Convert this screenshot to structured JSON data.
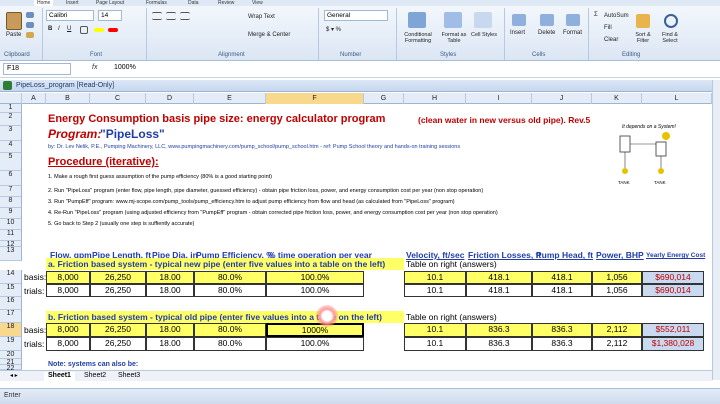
{
  "ribbon": {
    "tabs": [
      "Home",
      "Insert",
      "Page Layout",
      "Formulas",
      "Data",
      "Review",
      "View"
    ],
    "paste_label": "Paste",
    "font_name": "Calibri",
    "font_size": "14",
    "wrap_text": "Wrap Text",
    "merge_center": "Merge & Center",
    "number_format": "General",
    "conditional_formatting": "Conditional Formatting",
    "format_as_table": "Format as Table",
    "cell_styles": "Cell Styles",
    "insert": "Insert",
    "delete": "Delete",
    "format": "Format",
    "autosum": "AutoSum",
    "fill": "Fill",
    "clear": "Clear",
    "sort_filter": "Sort & Filter",
    "find_select": "Find & Select",
    "groups": [
      "Clipboard",
      "Font",
      "Alignment",
      "Number",
      "Styles",
      "Cells",
      "Editing"
    ]
  },
  "formula_bar": {
    "name_box": "F18",
    "fx": "fx",
    "value": "1000%"
  },
  "workbook": {
    "title": "PipeLoss_program  [Read-Only]"
  },
  "columns": [
    "A",
    "B",
    "C",
    "D",
    "E",
    "F",
    "G",
    "H",
    "I",
    "J",
    "K",
    "L"
  ],
  "rows": [
    "1",
    "2",
    "3",
    "4",
    "5",
    "6",
    "7",
    "8",
    "9",
    "10",
    "11",
    "12",
    "13",
    "14",
    "15",
    "16",
    "17",
    "18",
    "19",
    "20",
    "21",
    "22"
  ],
  "sheet": {
    "title_main": "Energy Consumption basis pipe size: energy calculator program",
    "title_sub": "(clean water in new versus old pipe). Rev.5",
    "program_label": "Program:",
    "program_name": "\"PipeLoss\"",
    "byline": "by: Dr. Lev Nelik, P.E., Pumping Machinery, LLC, www.pumpingmachinery.com/pump_school/pump_school.htm - ref: Pump School theory and hands-on training sessions",
    "procedure_heading": "Procedure (iterative):",
    "steps": [
      "1. Make a rough first guess assumption of the pump efficiency (80% is a good starting point)",
      "2. Run \"PipeLoss\" program (enter flow, pipe length, pipe diameter, guessed efficiency) - obtain pipe friction loss, power, and energy consumption cost per year (non stop operation)",
      "3. Run \"PumpEff\" program: www.mj-scope.com/pump_tools/pump_efficiency.htm to adjust pump efficiency from flow and head (as calculated from \"PipeLoss\" program)",
      "4. Re-Run \"PipeLoss\" program (using adjusted efficiency from \"PumpEff\" program - obtain corrected pipe friction loss, power, and energy consumption cost per year (non stop operation)",
      "5. Go back to Step 2 (usually one step is suffiently accurate)"
    ],
    "headers": [
      "Flow, gpm",
      "Pipe Length, ft",
      "Pipe Dia, in",
      "Pump Efficiency, %",
      "% time operation per year",
      "Velocity, ft/sec",
      "Friction Losses, ft",
      "Pump Head, ft",
      "Power, BHP",
      "Yearly Energy Cost"
    ],
    "section_a": "a. Friction based system - typical new pipe (enter five values into a table on the left)",
    "section_b": "b. Friction based system - typical old pipe (enter five values into a table on the left)",
    "table_on_right": "Table on right (answers)",
    "basis_label": "basis:",
    "trials_label": "trials:",
    "new_basis": [
      "8,000",
      "26,250",
      "18.00",
      "80.0%",
      "100.0%",
      "10.1",
      "418.1",
      "418.1",
      "1,056",
      "$690,014"
    ],
    "new_trials": [
      "8,000",
      "26,250",
      "18.00",
      "80.0%",
      "100.0%",
      "10.1",
      "418.1",
      "418.1",
      "1,056",
      "$690,014"
    ],
    "old_basis": [
      "8,000",
      "26,250",
      "18.00",
      "80.0%",
      "1000%",
      "10.1",
      "836.3",
      "836.3",
      "2,112",
      "$552,011"
    ],
    "old_trials": [
      "8,000",
      "26,250",
      "18.00",
      "80.0%",
      "100.0%",
      "10.1",
      "836.3",
      "836.3",
      "2,112",
      "$1,380,028"
    ],
    "note": "Note: systems can also be:",
    "diagram_caption": "It depends on a System!",
    "diagram_labels": [
      "TANK",
      "TANK"
    ]
  },
  "sheet_tabs": [
    "Sheet1",
    "Sheet2",
    "Sheet3"
  ],
  "status": "Enter",
  "colors": {
    "title_red": "#c00000",
    "link_blue": "#1f3da8",
    "yellow": "#ffff66",
    "header_blue": "#1f3da8"
  }
}
